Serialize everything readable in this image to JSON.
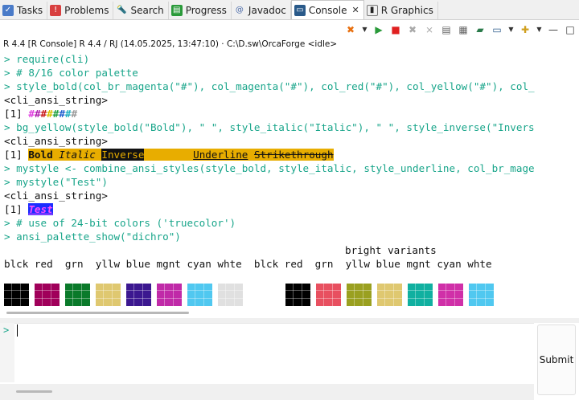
{
  "tabs": [
    {
      "label": "Tasks",
      "icon": "tasks-icon",
      "active": false
    },
    {
      "label": "Problems",
      "icon": "problems-icon",
      "active": false
    },
    {
      "label": "Search",
      "icon": "search-icon",
      "active": false
    },
    {
      "label": "Progress",
      "icon": "progress-icon",
      "active": false
    },
    {
      "label": "Javadoc",
      "icon": "javadoc-icon",
      "active": false
    },
    {
      "label": "Console",
      "icon": "console-icon",
      "active": true,
      "close": "✕"
    },
    {
      "label": "R Graphics",
      "icon": "r-graphics-icon",
      "active": false
    }
  ],
  "status_line": "R 4.4 [R Console] R 4.4 / RJ (14.05.2025, 13:47:10) · C:\\D.sw\\OrcaForge     <idle>",
  "console": {
    "lines": [
      {
        "kind": "cmd",
        "text": "> require(cli)"
      },
      {
        "kind": "cmd",
        "text": "> # 8/16 color palette"
      },
      {
        "kind": "cmd",
        "text": "> style_bold(col_br_magenta(\"#\"), col_magenta(\"#\"), col_red(\"#\"), col_yellow(\"#\"), col_"
      },
      {
        "kind": "out",
        "text": "<cli_ansi_string>"
      },
      {
        "kind": "out_hash",
        "prefix": "[1] ",
        "text": "########"
      },
      {
        "kind": "cmd",
        "text": "> bg_yellow(style_bold(\"Bold\"), \" \", style_italic(\"Italic\"), \" \", style_inverse(\"Invers"
      },
      {
        "kind": "out",
        "text": "<cli_ansi_string>"
      },
      {
        "kind": "out_styled",
        "prefix": "[1] ",
        "bold": "Bold",
        "italic": "Italic",
        "inverse": "Inverse",
        "underline": "Underline",
        "strike": "Strikethrough"
      },
      {
        "kind": "cmd",
        "text": "> mystyle <- combine_ansi_styles(style_bold, style_italic, style_underline, col_br_mage"
      },
      {
        "kind": "cmd",
        "text": "> mystyle(\"Test\")"
      },
      {
        "kind": "out",
        "text": "<cli_ansi_string>"
      },
      {
        "kind": "out_test",
        "prefix": "[1] ",
        "text": "Test"
      },
      {
        "kind": "cmd",
        "text": "> # use of 24-bit colors ('truecolor')"
      },
      {
        "kind": "cmd",
        "text": "> ansi_palette_show(\"dichro\")"
      }
    ],
    "palette_header": "bright variants",
    "palette_labels": "blck red  grn  yllw blue mgnt cyan whte  blck red  grn  yllw blue mgnt cyan whte"
  },
  "palette_colors": [
    "#000000",
    "#a0005a",
    "#0a7a2a",
    "#dfc870",
    "#3c1890",
    "#c02aa8",
    "#50c8f0",
    "#e0e0e0",
    "#000000",
    "#e85060",
    "#9aa020",
    "#dfc870",
    "#10b0a0",
    "#d030a8",
    "#50c8f0"
  ],
  "hash_colors": [
    "#e040e0",
    "#b020b0",
    "#c81818",
    "#d8c000",
    "#20a040",
    "#2060d0",
    "#20b0c0",
    "#9a9a9a"
  ],
  "input": {
    "prompt": ">",
    "value": ""
  },
  "submit_label": "Submit"
}
